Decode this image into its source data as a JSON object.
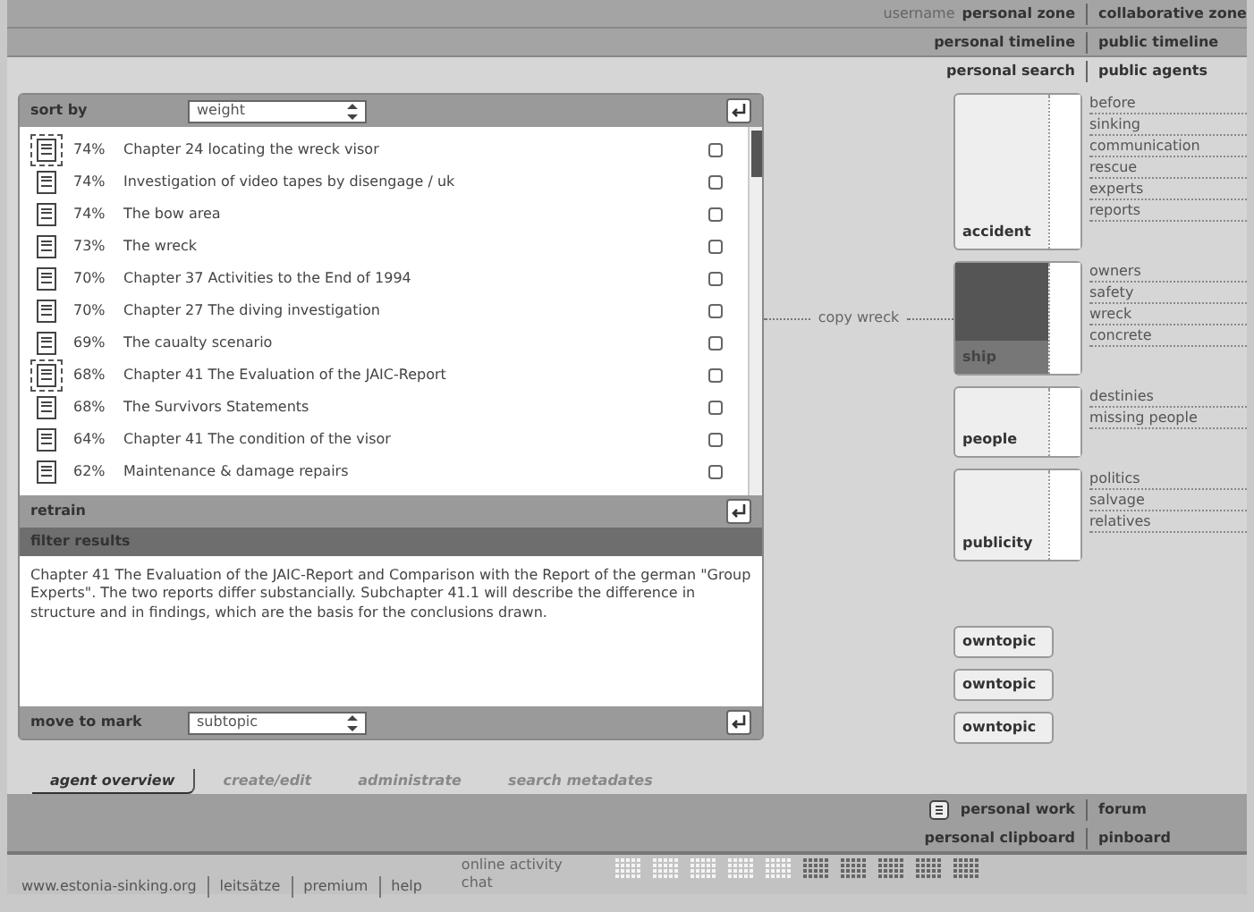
{
  "header_rows": [
    {
      "prefix": "username",
      "left": "personal zone",
      "right": "collaborative zone"
    },
    {
      "left": "personal timeline",
      "right": "public timeline"
    },
    {
      "left": "personal search",
      "right": "public agents"
    }
  ],
  "results_panel": {
    "sort_label": "sort by",
    "sort_value": "weight",
    "results": [
      {
        "score": "74%",
        "title": "Chapter 24 locating the wreck visor",
        "marked": true,
        "checked": false
      },
      {
        "score": "74%",
        "title": "Investigation of video tapes by disengage / uk",
        "marked": false,
        "checked": false
      },
      {
        "score": "74%",
        "title": "The bow area",
        "marked": false,
        "checked": false
      },
      {
        "score": "73%",
        "title": "The wreck",
        "marked": false,
        "checked": false
      },
      {
        "score": "70%",
        "title": "Chapter 37 Activities to the End of 1994",
        "marked": false,
        "checked": false
      },
      {
        "score": "70%",
        "title": "Chapter 27 The diving investigation",
        "marked": false,
        "checked": false
      },
      {
        "score": "69%",
        "title": "The caualty scenario",
        "marked": false,
        "checked": false
      },
      {
        "score": "68%",
        "title": "Chapter 41 The Evaluation of the JAIC-Report",
        "marked": true,
        "checked": false
      },
      {
        "score": "68%",
        "title": "The Survivors Statements",
        "marked": false,
        "checked": false
      },
      {
        "score": "64%",
        "title": "Chapter 41 The condition of the visor",
        "marked": false,
        "checked": false
      },
      {
        "score": "62%",
        "title": "Maintenance & damage repairs",
        "marked": false,
        "checked": false
      }
    ],
    "retrain_label": "retrain",
    "filter_label": "filter results",
    "description": "Chapter 41 The Evaluation of the JAIC-Report and Comparison with the Report of the german \"Group Experts\". The two reports differ substancially. Subchapter 41.1 will describe the difference in structure and in findings, which are the basis for the conclusions drawn.",
    "move_label": "move to mark",
    "move_value": "subtopic"
  },
  "link_label": "copy wreck",
  "agents": [
    {
      "kind": "topic",
      "label": "accident",
      "selected": false,
      "subtopics": [
        "before",
        "sinking",
        "communication",
        "rescue",
        "experts",
        "reports"
      ]
    },
    {
      "kind": "topic",
      "label": "ship",
      "selected": true,
      "subtopics": [
        "owners",
        "safety",
        "wreck",
        "concrete"
      ]
    },
    {
      "kind": "topic",
      "label": "people",
      "selected": false,
      "subtopics": [
        "destinies",
        "missing people"
      ]
    },
    {
      "kind": "topic",
      "label": "publicity",
      "selected": false,
      "subtopics": [
        "politics",
        "salvage",
        "relatives"
      ]
    },
    {
      "kind": "own",
      "label": "owntopic"
    },
    {
      "kind": "own",
      "label": "owntopic"
    },
    {
      "kind": "own",
      "label": "owntopic"
    }
  ],
  "tabs": [
    {
      "label": "agent overview",
      "selected": true
    },
    {
      "label": "create/edit",
      "selected": false
    },
    {
      "label": "administrate",
      "selected": false
    },
    {
      "label": "search metadates",
      "selected": false
    }
  ],
  "bottom_rows": [
    {
      "left": "personal work",
      "right": "forum"
    },
    {
      "left": "personal clipboard",
      "right": "pinboard"
    }
  ],
  "footer": {
    "links": [
      "www.estonia-sinking.org",
      "leitsätze",
      "premium",
      "help"
    ],
    "status": [
      "online activity",
      "chat"
    ]
  }
}
